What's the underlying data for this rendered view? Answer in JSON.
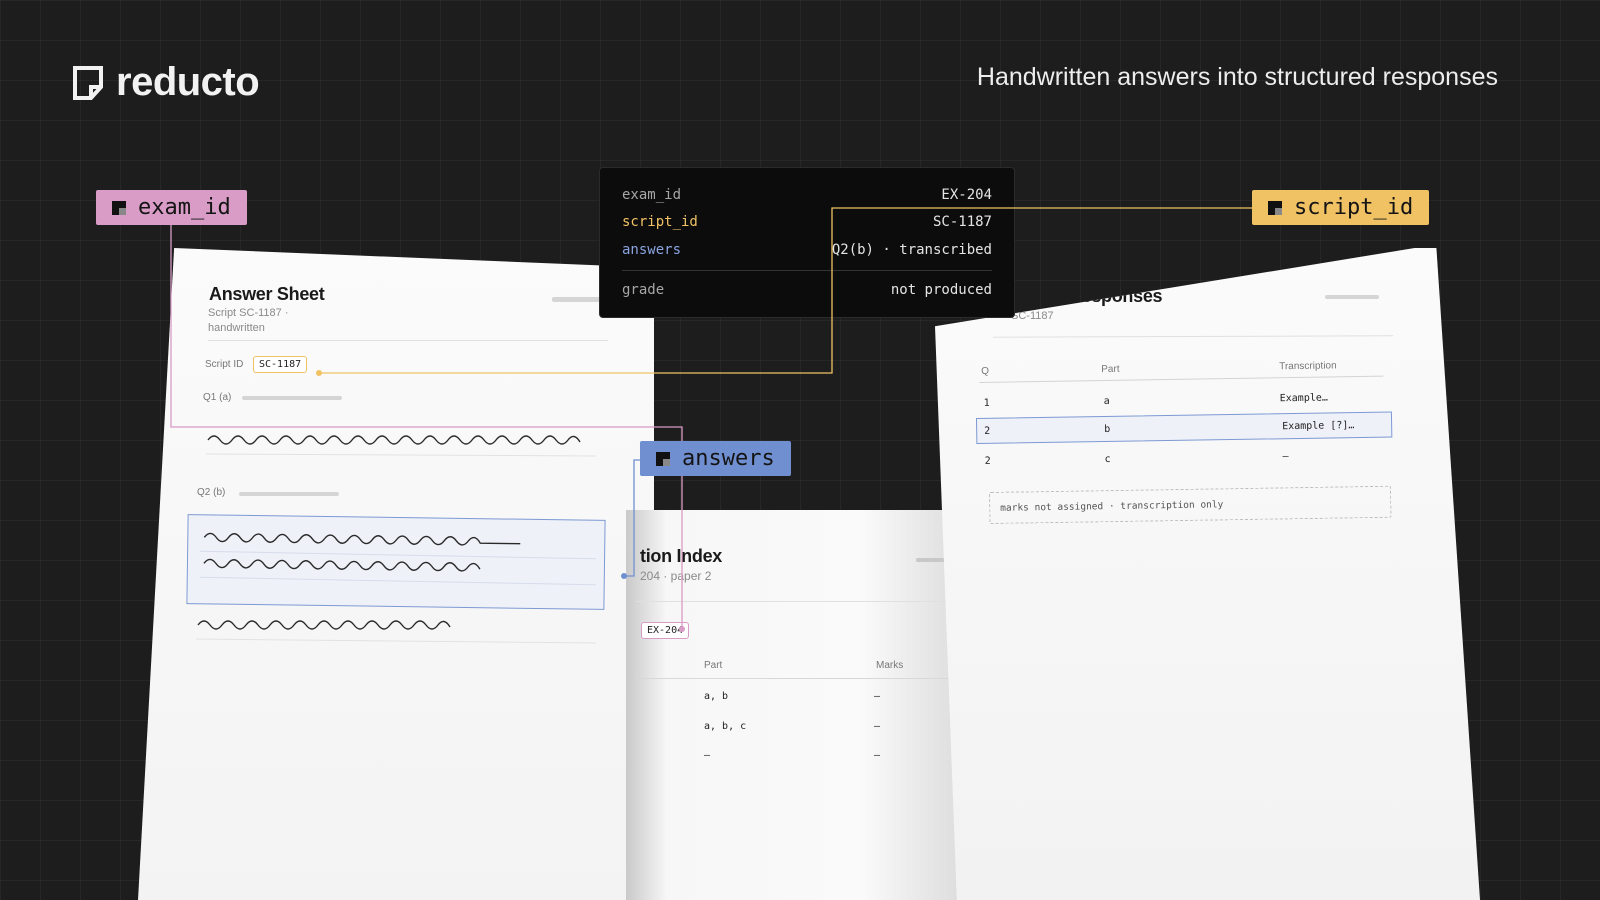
{
  "brand": {
    "name": "reducto",
    "tagline": "Handwritten answers into structured responses"
  },
  "colors": {
    "exam_id": "#d89cc6",
    "script_id": "#f0c264",
    "answers": "#6f8fd0",
    "background": "#1d1d1d"
  },
  "pills": {
    "exam_id": "exam_id",
    "script_id": "script_id",
    "answers": "answers"
  },
  "record": {
    "rows": [
      {
        "key": "exam_id",
        "value": "EX-204"
      },
      {
        "key": "script_id",
        "value": "SC-1187"
      },
      {
        "key": "answers",
        "value": "Q2(b) · transcribed"
      },
      {
        "key": "grade",
        "value": "not produced"
      }
    ]
  },
  "answer_sheet": {
    "title": "Answer Sheet",
    "subtitle_1": "Script SC-1187 ·",
    "subtitle_2": "handwritten",
    "script_id_label": "Script ID",
    "script_id_value": "SC-1187",
    "q1_label": "Q1 (a)",
    "q2_label": "Q2 (b)"
  },
  "index_doc": {
    "title": "tion Index",
    "subtitle": "204 · paper 2",
    "exam_tag": "EX-204",
    "headers": {
      "part": "Part",
      "marks": "Marks"
    },
    "rows": [
      {
        "part": "a, b",
        "marks": "–"
      },
      {
        "part": "a, b, c",
        "marks": "–"
      },
      {
        "part": "–",
        "marks": "–"
      }
    ]
  },
  "responses_doc": {
    "title": "ctured Responses",
    "subtitle": "SC-1187",
    "headers": {
      "q": "Q",
      "part": "Part",
      "transcription": "Transcription"
    },
    "rows": [
      {
        "q": "1",
        "part": "a",
        "transcription": "Example…"
      },
      {
        "q": "2",
        "part": "b",
        "transcription": "Example [?]…"
      },
      {
        "q": "2",
        "part": "c",
        "transcription": "–"
      }
    ],
    "note": "marks not assigned · transcription only"
  }
}
